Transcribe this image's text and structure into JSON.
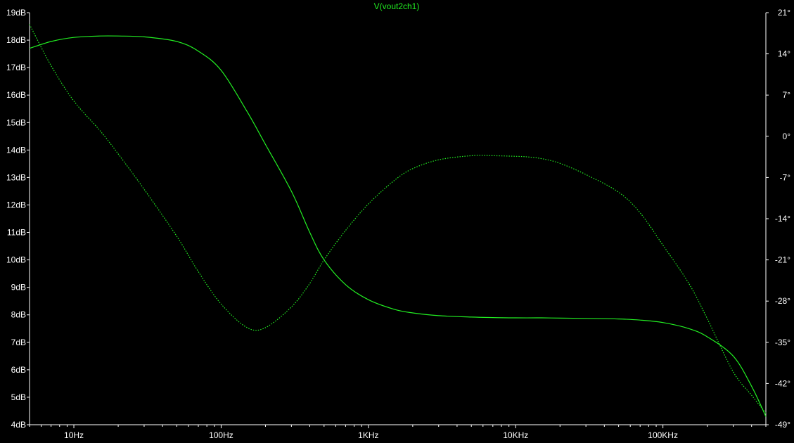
{
  "chart_data": {
    "type": "line",
    "title": "V(vout2ch1)",
    "xscale": "log",
    "xlim": [
      5,
      500000
    ],
    "x_ticks": [
      10,
      100,
      1000,
      10000,
      100000
    ],
    "x_tick_labels": [
      "10Hz",
      "100Hz",
      "1KHz",
      "10KHz",
      "100KHz"
    ],
    "ylim_left": [
      4,
      19
    ],
    "y_left_ticks": [
      4,
      5,
      6,
      7,
      8,
      9,
      10,
      11,
      12,
      13,
      14,
      15,
      16,
      17,
      18,
      19
    ],
    "y_left_tick_labels": [
      "4dB",
      "5dB",
      "6dB",
      "7dB",
      "8dB",
      "9dB",
      "10dB",
      "11dB",
      "12dB",
      "13dB",
      "14dB",
      "15dB",
      "16dB",
      "17dB",
      "18dB",
      "19dB"
    ],
    "ylim_right": [
      -49,
      21
    ],
    "y_right_ticks": [
      21,
      14,
      7,
      0,
      -7,
      -14,
      -21,
      -28,
      -35,
      -42,
      -49
    ],
    "y_right_tick_labels": [
      "21°",
      "14°",
      "7°",
      "0°",
      "-7°",
      "-14°",
      "-21°",
      "-28°",
      "-35°",
      "-42°",
      "-49°"
    ],
    "grid": false,
    "colors": {
      "background": "#000000",
      "trace": "#22ee22",
      "axis": "#ffffff",
      "tick_text": "#ffffff",
      "title_text": "#22ee22"
    },
    "series": [
      {
        "axis": "left",
        "style": "solid",
        "x": [
          5,
          7,
          10,
          15,
          20,
          30,
          50,
          70,
          100,
          150,
          200,
          300,
          400,
          500,
          700,
          1000,
          1500,
          2000,
          3000,
          5000,
          7000,
          10000,
          15000,
          20000,
          30000,
          50000,
          70000,
          100000,
          150000,
          200000,
          300000,
          400000,
          500000
        ],
        "values": [
          17.7,
          17.95,
          18.1,
          18.15,
          18.15,
          18.12,
          17.95,
          17.6,
          16.9,
          15.4,
          14.2,
          12.5,
          11.0,
          10.0,
          9.1,
          8.55,
          8.2,
          8.07,
          7.97,
          7.92,
          7.9,
          7.89,
          7.89,
          7.88,
          7.87,
          7.85,
          7.81,
          7.72,
          7.5,
          7.2,
          6.5,
          5.4,
          4.3
        ]
      },
      {
        "axis": "right",
        "style": "dotted",
        "x": [
          5,
          7,
          10,
          15,
          20,
          30,
          50,
          70,
          100,
          150,
          200,
          300,
          400,
          500,
          700,
          1000,
          1500,
          2000,
          3000,
          5000,
          7000,
          10000,
          12000,
          15000,
          20000,
          30000,
          50000,
          70000,
          100000,
          150000,
          200000,
          300000,
          400000,
          500000
        ],
        "values": [
          19,
          12,
          6,
          1,
          -3,
          -9,
          -17,
          -23,
          -28.5,
          -32.5,
          -32.5,
          -29,
          -25,
          -21,
          -16,
          -11.5,
          -7.5,
          -5.5,
          -4,
          -3.3,
          -3.3,
          -3.4,
          -3.5,
          -3.8,
          -4.6,
          -6.5,
          -9.5,
          -13,
          -18.5,
          -25,
          -31,
          -40,
          -44,
          -47
        ]
      }
    ]
  }
}
